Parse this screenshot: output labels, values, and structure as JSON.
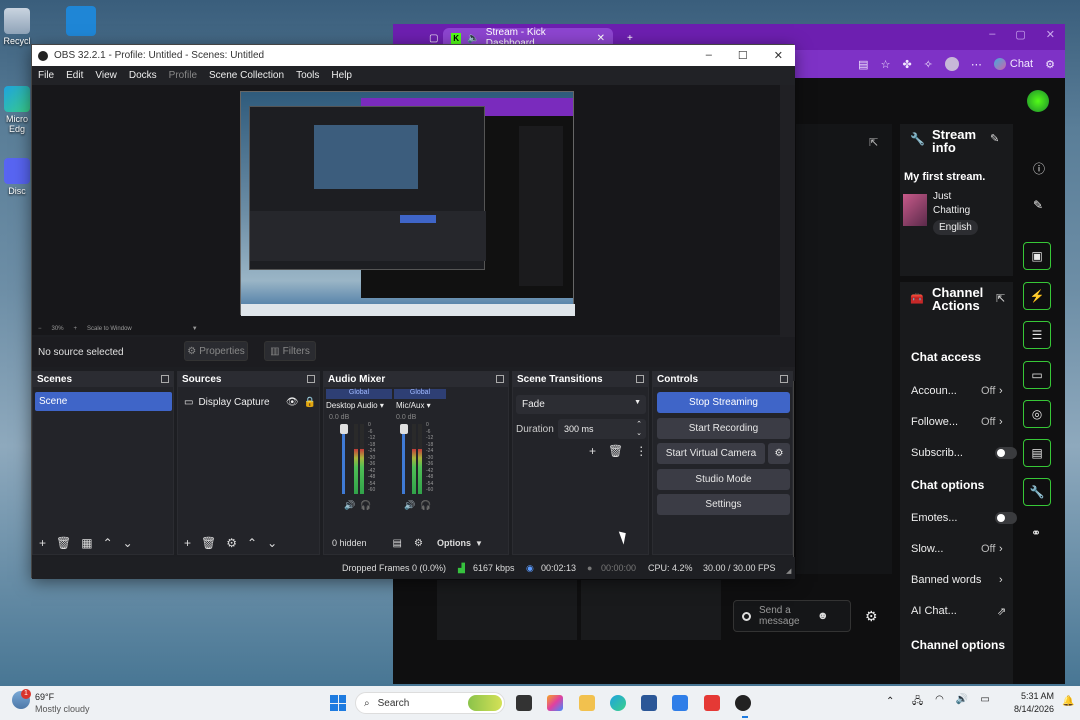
{
  "desktop": {
    "icons": [
      "Recycl",
      "Micro Edg",
      "Disc"
    ]
  },
  "browser": {
    "tab_title": "Stream - Kick Dashboard",
    "toolbar_chat": "Chat",
    "stream_info": {
      "title": "Stream info",
      "stream_title": "My first stream.",
      "category": "Just Chatting",
      "language": "English"
    },
    "channel_actions": {
      "title": "Channel Actions",
      "chat_access_title": "Chat access",
      "rows": [
        {
          "label": "Accoun...",
          "value": "Off"
        },
        {
          "label": "Followe...",
          "value": "Off"
        }
      ],
      "subscribers_label": "Subscrib...",
      "chat_options_title": "Chat options",
      "emotes_label": "Emotes...",
      "slow_label": "Slow...",
      "slow_value": "Off",
      "banned_words": "Banned words",
      "ai_chat": "AI Chat...",
      "channel_options": "Channel options"
    },
    "send_placeholder": "Send a message"
  },
  "obs": {
    "title": "OBS 32.2.1 - Profile: Untitled - Scenes: Untitled",
    "menu": [
      "File",
      "Edit",
      "View",
      "Docks",
      "Profile",
      "Scene Collection",
      "Tools",
      "Help"
    ],
    "zoom": "30%",
    "scale": "Scale to Window",
    "no_source": "No source selected",
    "properties": "Properties",
    "filters": "Filters",
    "scenes": {
      "title": "Scenes",
      "items": [
        "Scene"
      ]
    },
    "sources": {
      "title": "Sources",
      "items": [
        "Display Capture"
      ]
    },
    "mixer": {
      "title": "Audio Mixer",
      "channels": [
        {
          "tag": "Global",
          "name": "Desktop Audio",
          "db": "0.0 dB"
        },
        {
          "tag": "Global",
          "name": "Mic/Aux",
          "db": "0.0 dB"
        }
      ],
      "hidden": "0 hidden",
      "options": "Options",
      "scale": [
        "0",
        "-6",
        "-12",
        "-18",
        "-24",
        "-30",
        "-36",
        "-42",
        "-48",
        "-54",
        "-60"
      ]
    },
    "transitions": {
      "title": "Scene Transitions",
      "type": "Fade",
      "duration_label": "Duration",
      "duration": "300 ms"
    },
    "controls": {
      "title": "Controls",
      "stop_streaming": "Stop Streaming",
      "start_recording": "Start Recording",
      "virtual_camera": "Start Virtual Camera",
      "studio_mode": "Studio Mode",
      "settings": "Settings"
    },
    "status": {
      "dropped": "Dropped Frames 0 (0.0%)",
      "kbps": "6167 kbps",
      "stream_time": "00:02:13",
      "rec_time": "00:00:00",
      "cpu": "CPU: 4.2%",
      "fps": "30.00 / 30.00 FPS"
    }
  },
  "taskbar": {
    "weather_temp": "69°F",
    "weather_desc": "Mostly cloudy",
    "search": "Search",
    "time": "5:31 AM",
    "date": "8/14/2026",
    "badge": "1"
  },
  "colors": {
    "kick_green": "#53fc18",
    "obs_blue": "#3f65c8",
    "browser_purple": "#7a2bbd"
  }
}
